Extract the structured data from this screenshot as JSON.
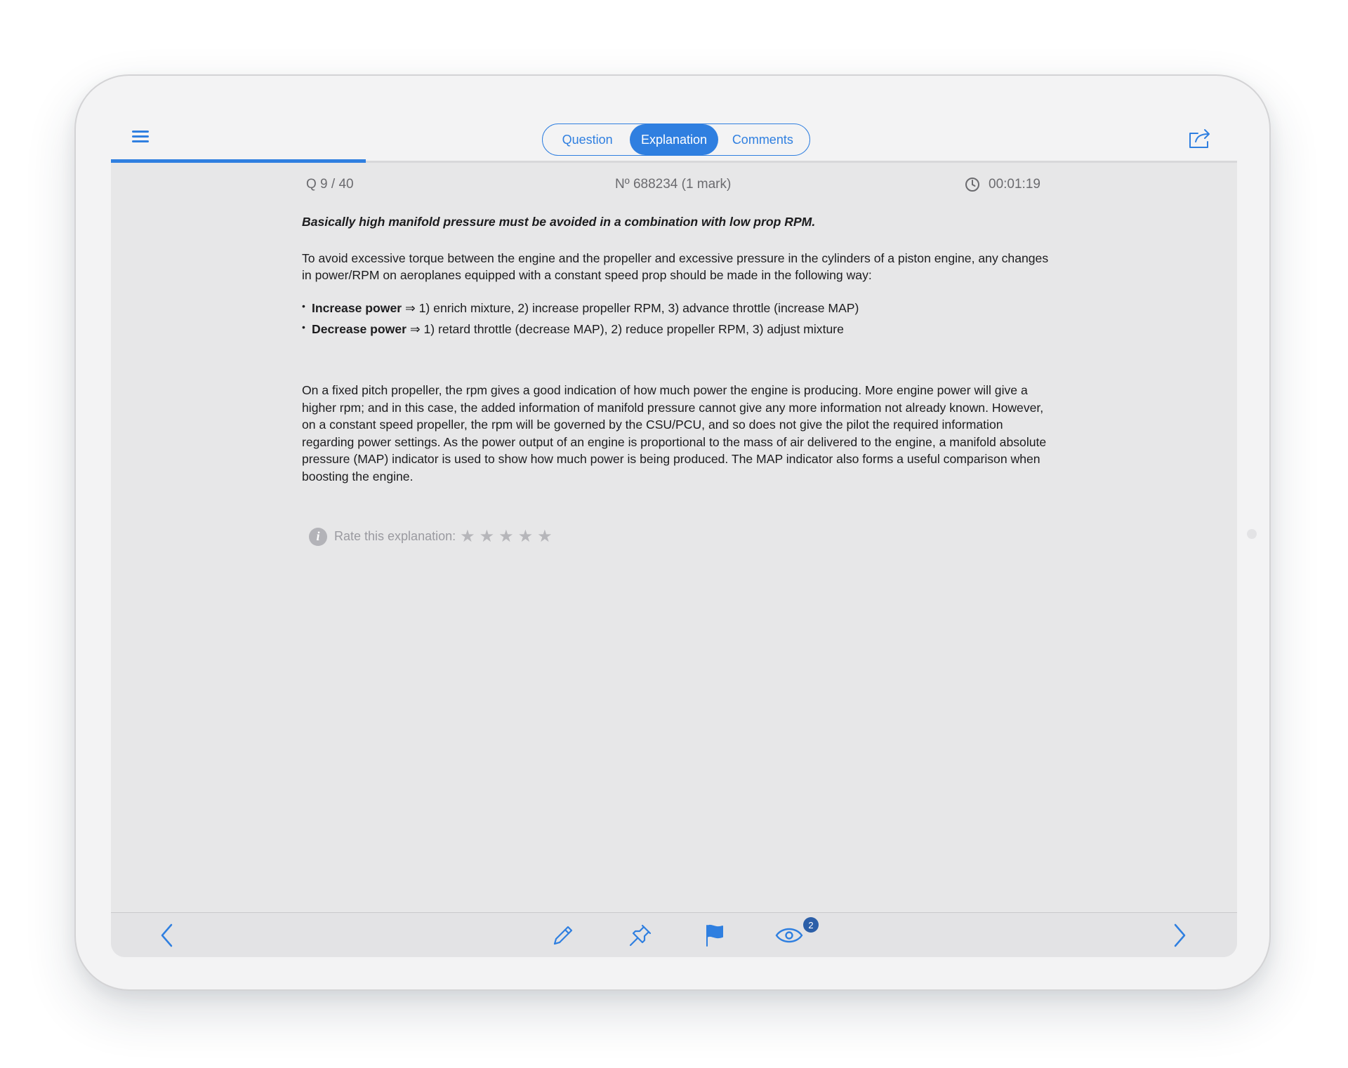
{
  "tabs": [
    {
      "label": "Question",
      "active": false
    },
    {
      "label": "Explanation",
      "active": true
    },
    {
      "label": "Comments",
      "active": false
    }
  ],
  "progress": {
    "fraction": 0.226
  },
  "meta": {
    "question_counter": "Q  9 / 40",
    "question_number": "Nº 688234 (1 mark)",
    "timer": "00:01:19"
  },
  "explanation": {
    "lead": "Basically high manifold pressure must be avoided in a combination with low prop RPM.",
    "intro": "To avoid excessive torque between the engine and the propeller and excessive pressure in the cylinders of a piston engine, any changes in power/RPM on aeroplanes equipped with a constant speed prop should be made in the following way:",
    "bullets": [
      {
        "bold": "Increase power",
        "text": " ⇒ 1) enrich mixture, 2) increase propeller RPM, 3) advance throttle (increase MAP)"
      },
      {
        "bold": "Decrease power",
        "text": " ⇒ 1) retard throttle (decrease MAP), 2) reduce propeller RPM, 3) adjust mixture"
      }
    ],
    "body": "On a fixed pitch propeller, the rpm gives a good indication of how much power the engine is producing. More engine power will give a higher rpm; and in this case, the added information of manifold pressure cannot give any more information not already known. However, on a constant speed propeller, the rpm will be governed by the CSU/PCU, and so does not give the pilot the required information regarding power settings. As the power output of an engine is proportional to the mass of air delivered to the engine, a manifold absolute pressure (MAP) indicator is used to show how much power is being produced. The MAP indicator also forms a useful comparison when boosting the engine."
  },
  "rating": {
    "label": "Rate this explanation:",
    "star_glyph": "★",
    "max_stars": 5,
    "value": 0
  },
  "toolbar": {
    "icons": [
      "chevron-left-icon",
      "pencil-icon",
      "pin-icon",
      "flag-icon",
      "eye-icon",
      "chevron-right-icon"
    ],
    "views_badge": "2"
  },
  "colors": {
    "accent": "#2f7fe0",
    "screen_bg": "#e7e7e8",
    "text": "#1c1c1e",
    "muted": "#6b6b6f",
    "badge": "#2c5fa8"
  }
}
